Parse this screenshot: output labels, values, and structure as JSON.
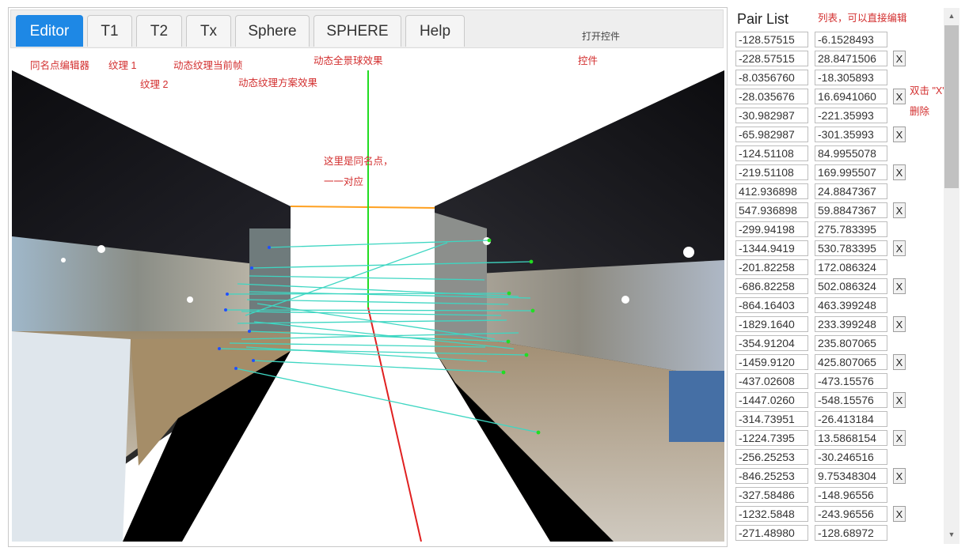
{
  "tabs": [
    {
      "label": "Editor",
      "active": true
    },
    {
      "label": "T1"
    },
    {
      "label": "T2"
    },
    {
      "label": "Tx"
    },
    {
      "label": "Sphere"
    },
    {
      "label": "SPHERE"
    },
    {
      "label": "Help"
    }
  ],
  "controls_label": "打开控件",
  "annotations": {
    "editor": "同名点编辑器",
    "t1": "纹理 1",
    "t2": "纹理 2",
    "tx": "动态纹理当前帧",
    "sphere": "动态纹理方案效果",
    "sphere_big": "动态全景球效果",
    "controls": "控件",
    "same_points_1": "这里是同名点，",
    "same_points_2": "一一对应",
    "list_note": "列表，可以直接编辑",
    "delete_note_1": "双击 \"X\"",
    "delete_note_2": "删除"
  },
  "pair_list": {
    "title": "Pair List",
    "delete_label": "X",
    "rows": [
      {
        "a": "-128.57515",
        "b": "-6.1528493",
        "x": false
      },
      {
        "a": "-228.57515",
        "b": "28.8471506",
        "x": true
      },
      {
        "a": "-8.0356760",
        "b": "-18.305893",
        "x": false
      },
      {
        "a": "-28.035676",
        "b": "16.6941060",
        "x": true
      },
      {
        "a": "-30.982987",
        "b": "-221.35993",
        "x": false
      },
      {
        "a": "-65.982987",
        "b": "-301.35993",
        "x": true
      },
      {
        "a": "-124.51108",
        "b": "84.9955078",
        "x": false
      },
      {
        "a": "-219.51108",
        "b": "169.995507",
        "x": true
      },
      {
        "a": "412.936898",
        "b": "24.8847367",
        "x": false
      },
      {
        "a": "547.936898",
        "b": "59.8847367",
        "x": true
      },
      {
        "a": "-299.94198",
        "b": "275.783395",
        "x": false
      },
      {
        "a": "-1344.9419",
        "b": "530.783395",
        "x": true
      },
      {
        "a": "-201.82258",
        "b": "172.086324",
        "x": false
      },
      {
        "a": "-686.82258",
        "b": "502.086324",
        "x": true
      },
      {
        "a": "-864.16403",
        "b": "463.399248",
        "x": false
      },
      {
        "a": "-1829.1640",
        "b": "233.399248",
        "x": true
      },
      {
        "a": "-354.91204",
        "b": "235.807065",
        "x": false
      },
      {
        "a": "-1459.9120",
        "b": "425.807065",
        "x": true
      },
      {
        "a": "-437.02608",
        "b": "-473.15576",
        "x": false
      },
      {
        "a": "-1447.0260",
        "b": "-548.15576",
        "x": true
      },
      {
        "a": "-314.73951",
        "b": "-26.413184",
        "x": false
      },
      {
        "a": "-1224.7395",
        "b": "13.5868154",
        "x": true
      },
      {
        "a": "-256.25253",
        "b": "-30.246516",
        "x": false
      },
      {
        "a": "-846.25253",
        "b": "9.75348304",
        "x": true
      },
      {
        "a": "-327.58486",
        "b": "-148.96556",
        "x": false
      },
      {
        "a": "-1232.5848",
        "b": "-243.96556",
        "x": true
      },
      {
        "a": "-271.48980",
        "b": "-128.68972",
        "x": false
      }
    ]
  },
  "colors": {
    "active_tab": "#1e88e5",
    "note_red": "#d32f2f",
    "match_line": "#3ed6c2",
    "axis_green": "#22dd22",
    "axis_red": "#e02020",
    "axis_orange": "#ffa020"
  }
}
